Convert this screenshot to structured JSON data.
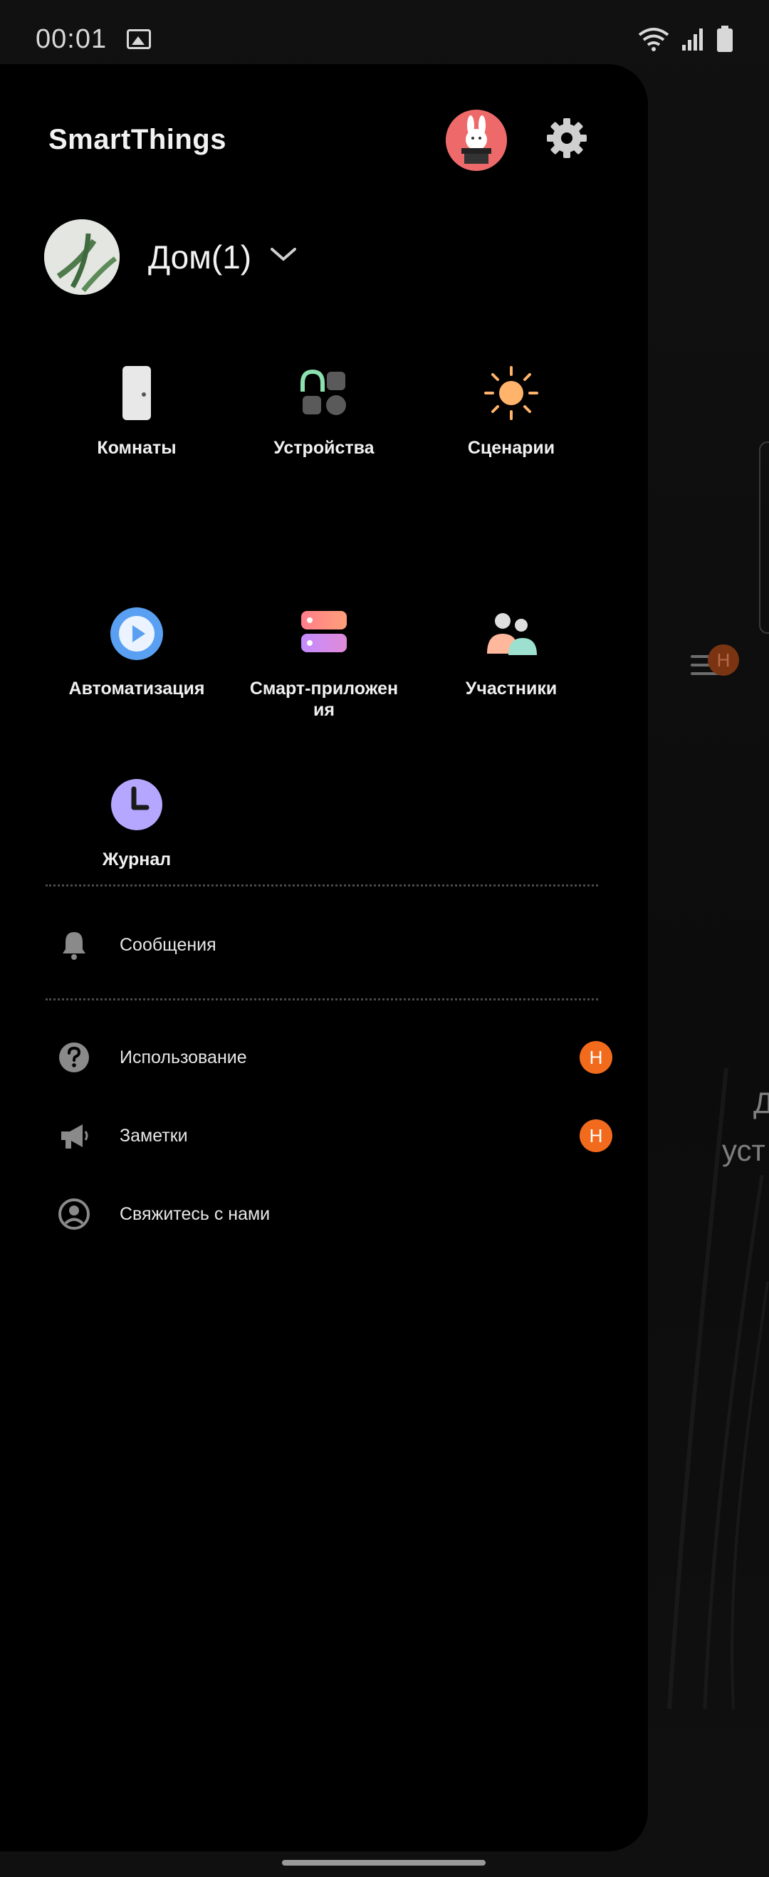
{
  "status_bar": {
    "time": "00:01"
  },
  "drawer": {
    "brand": "SmartThings",
    "home": {
      "name": "Дом(1)"
    },
    "grid": [
      {
        "label": "Комнаты"
      },
      {
        "label": "Устройства"
      },
      {
        "label": "Сценарии"
      },
      {
        "label": "Автоматизация"
      },
      {
        "label": "Смарт-приложен\nия"
      },
      {
        "label": "Участники"
      },
      {
        "label": "Журнал"
      }
    ],
    "menu": [
      {
        "label": "Сообщения"
      },
      {
        "label": "Использование",
        "badge": "Н"
      },
      {
        "label": "Заметки",
        "badge": "Н"
      },
      {
        "label": "Свяжитесь с нами"
      }
    ]
  },
  "background": {
    "badge": "Н",
    "text1": "Д",
    "text2": "уст"
  },
  "colors": {
    "badge": "#f26b1d",
    "drawer_bg": "#000000",
    "scene_sun": "#ffb36b",
    "automation_blue": "#5aa0f2",
    "history_purple": "#b5a6ff"
  }
}
